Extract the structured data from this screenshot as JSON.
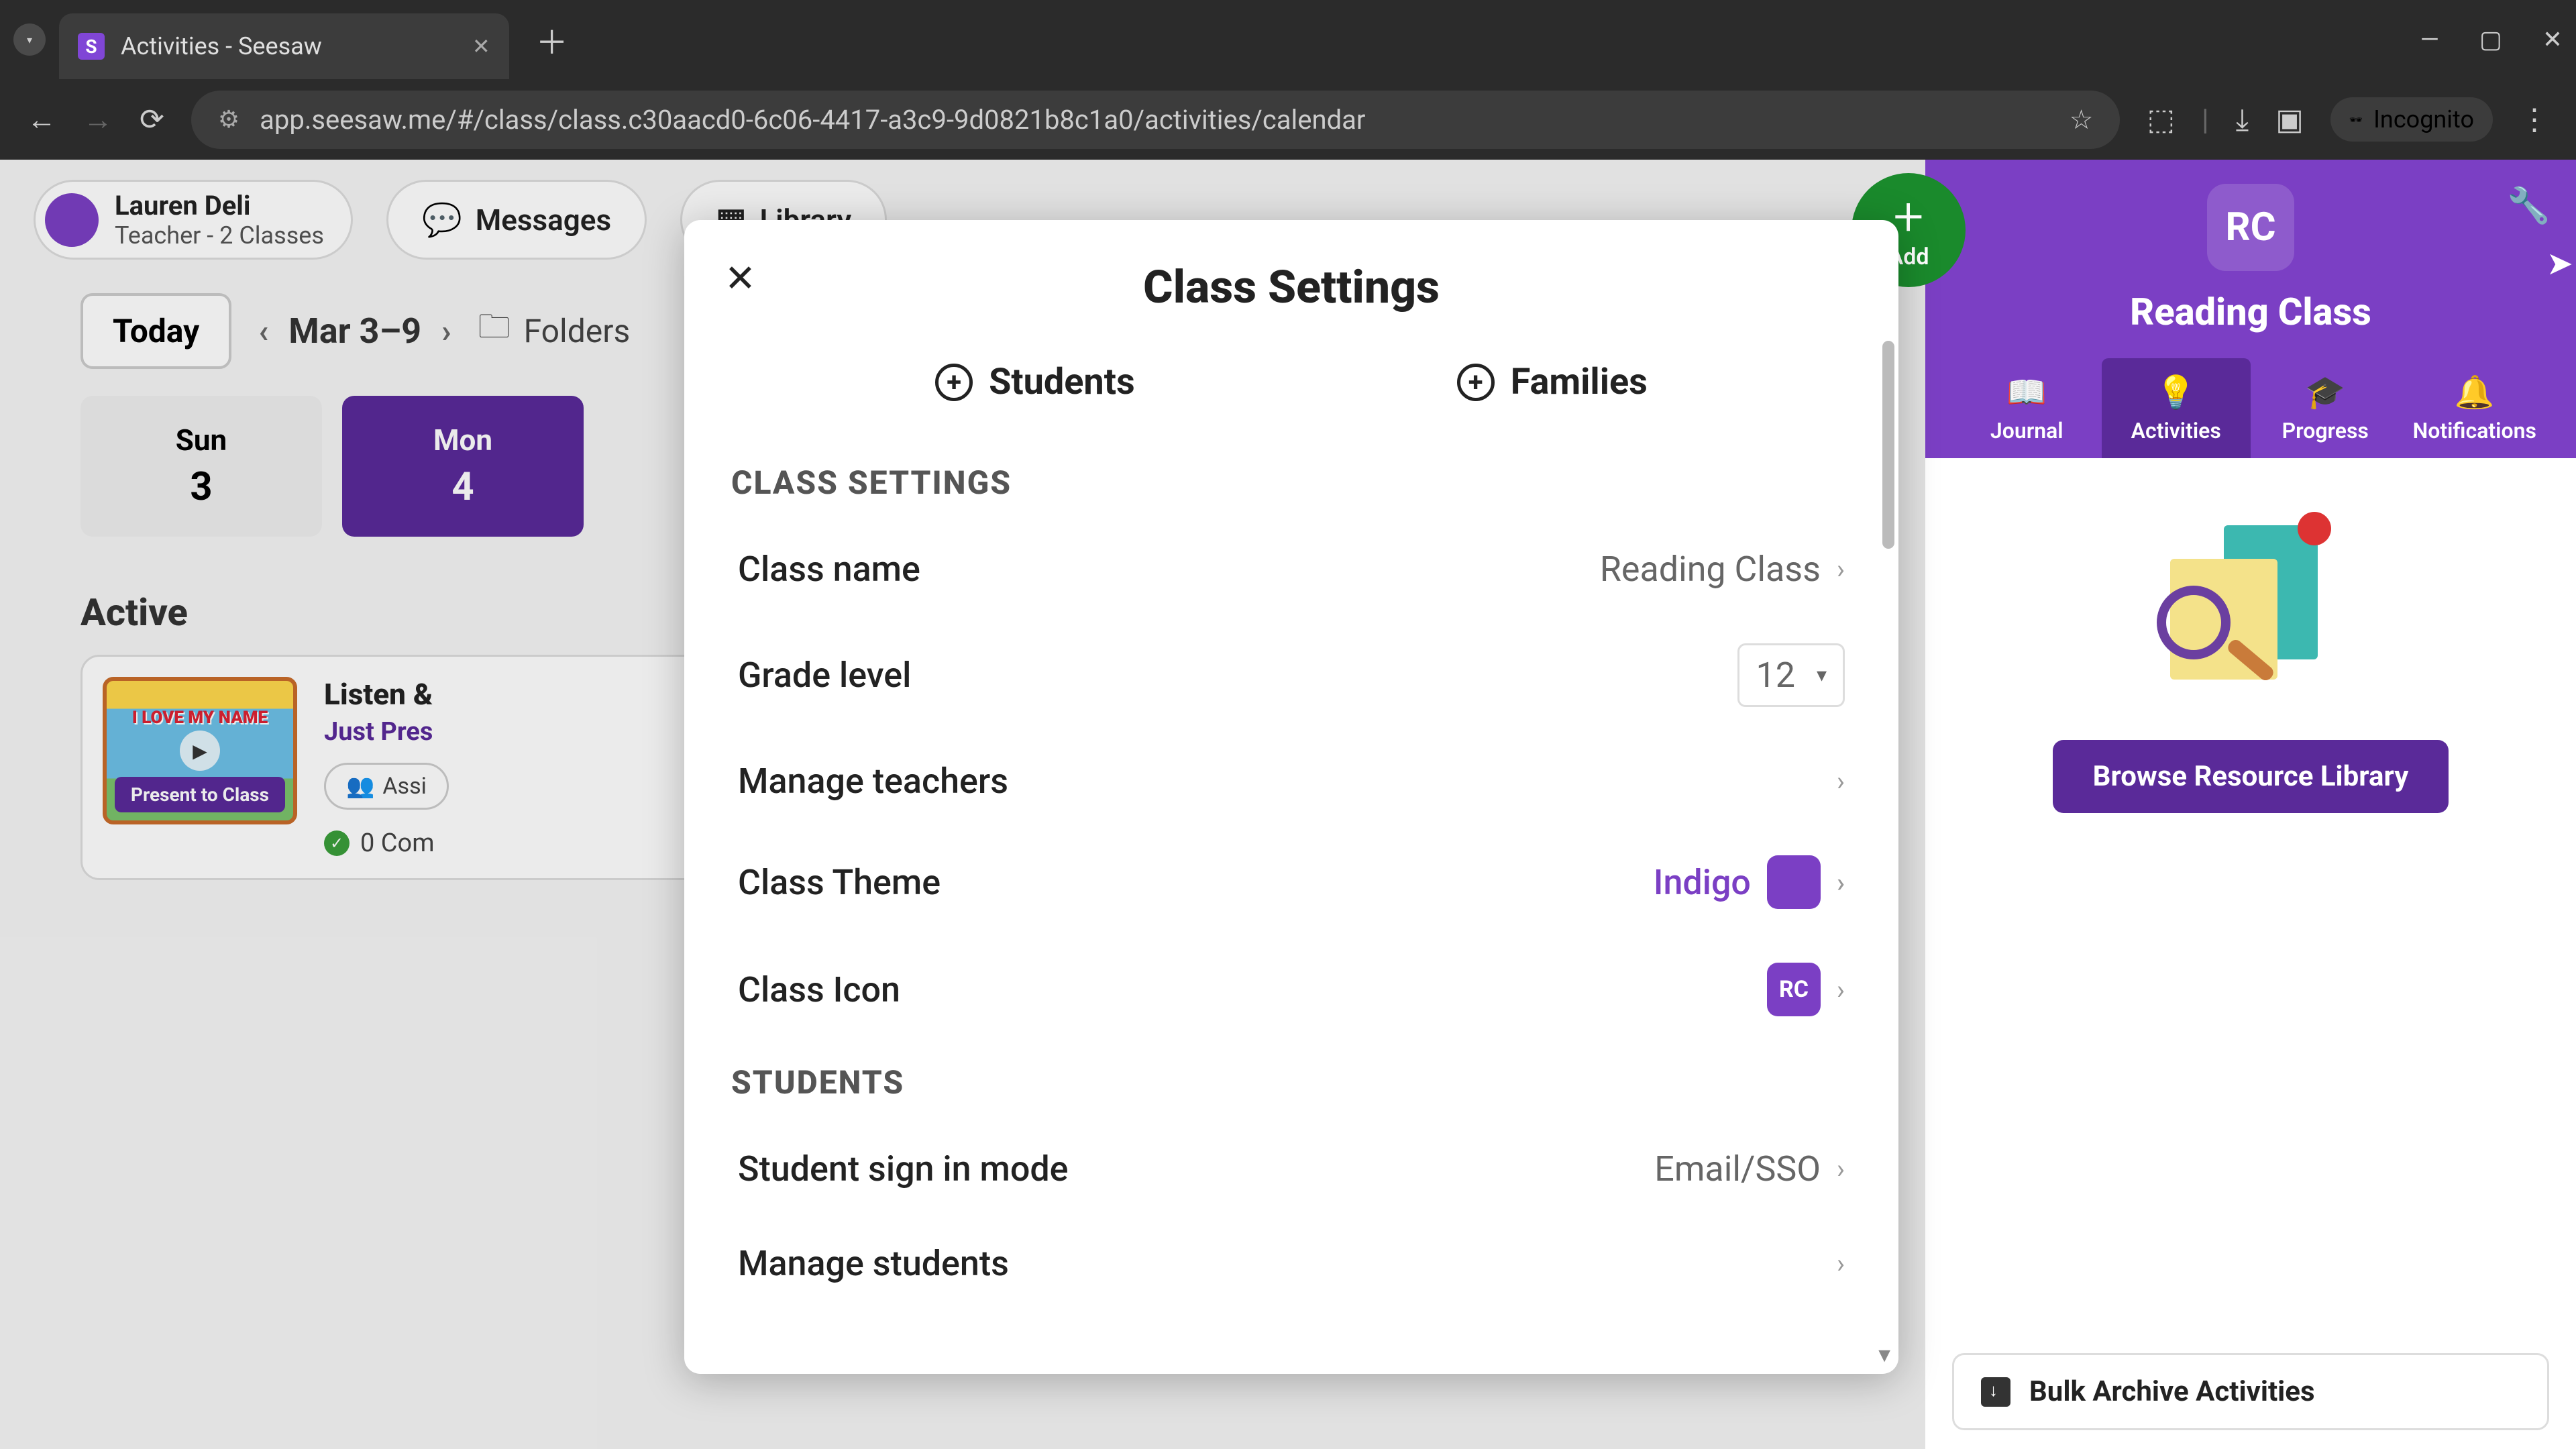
{
  "browser": {
    "tab_title": "Activities - Seesaw",
    "url": "app.seesaw.me/#/class/class.c30aacd0-6c06-4417-a3c9-9d0821b8c1a0/activities/calendar",
    "incognito_label": "Incognito"
  },
  "header": {
    "user_name": "Lauren Deli",
    "user_role": "Teacher - 2 Classes",
    "messages_label": "Messages",
    "library_label": "Library"
  },
  "toolbar": {
    "today_label": "Today",
    "date_range": "Mar 3–9",
    "folders_label": "Folders"
  },
  "days": [
    {
      "name": "Sun",
      "num": "3",
      "active": false
    },
    {
      "name": "Mon",
      "num": "4",
      "active": true
    }
  ],
  "active_section_title": "Active",
  "activity": {
    "thumb_text": "I LOVE MY NAME",
    "present_label": "Present to Class",
    "title": "Listen &",
    "subtitle": "Just Pres",
    "assigned_label": "Assi",
    "completed_label": "0 Com"
  },
  "right_panel": {
    "add_label": "Add",
    "class_initials": "RC",
    "class_name": "Reading Class",
    "tabs": {
      "journal": "Journal",
      "activities": "Activities",
      "progress": "Progress",
      "notifications": "Notifications"
    },
    "browse_library": "Browse Resource Library",
    "bulk_archive": "Bulk Archive Activities"
  },
  "modal": {
    "title": "Class Settings",
    "students_btn": "Students",
    "families_btn": "Families",
    "section_class_settings": "CLASS SETTINGS",
    "section_students": "STUDENTS",
    "rows": {
      "class_name": {
        "label": "Class name",
        "value": "Reading Class"
      },
      "grade_level": {
        "label": "Grade level",
        "value": "12"
      },
      "manage_teachers": {
        "label": "Manage teachers"
      },
      "class_theme": {
        "label": "Class Theme",
        "value": "Indigo"
      },
      "class_icon": {
        "label": "Class Icon",
        "value": "RC"
      },
      "signin_mode": {
        "label": "Student sign in mode",
        "value": "Email/SSO"
      },
      "manage_students": {
        "label": "Manage students"
      }
    }
  }
}
